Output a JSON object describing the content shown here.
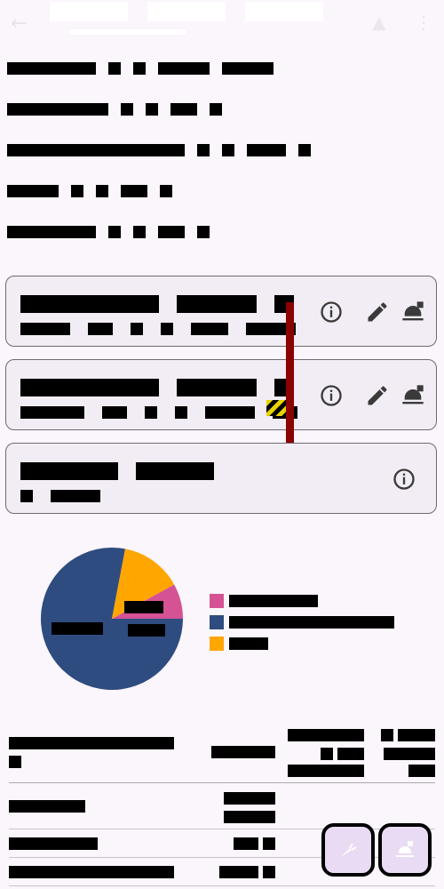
{
  "app_bar": {
    "back_icon": "arrow-back-icon",
    "tabs": [
      {
        "label": "Tab 1"
      },
      {
        "label": "Tab 2"
      },
      {
        "label": "Tab 3"
      }
    ],
    "actions": [
      "food-fire-icon",
      "more-vert-icon"
    ]
  },
  "details": [
    {
      "label": "Info line 1"
    },
    {
      "label": "Info line 2"
    },
    {
      "label": "Info line 3"
    },
    {
      "label": "Info line 4"
    },
    {
      "label": "Info line 5"
    }
  ],
  "cards": [
    {
      "title": "Card 1",
      "subtitle": "Details",
      "actions": [
        "info-icon",
        "edit-icon",
        "dish-icon"
      ]
    },
    {
      "title": "Card 2",
      "subtitle": "Details",
      "actions": [
        "info-icon",
        "edit-icon",
        "dish-icon"
      ]
    },
    {
      "title": "Card 3",
      "subtitle": "Details",
      "actions": [
        "info-icon"
      ]
    }
  ],
  "chart_data": {
    "type": "pie",
    "slices": [
      {
        "value": 8,
        "color": "#d55294"
      },
      {
        "value": 78,
        "color": "#2e4c7f"
      },
      {
        "value": 14,
        "color": "#ffa600"
      }
    ]
  },
  "table": {
    "headers": [
      "Header 1",
      "Header 2",
      "Header 3",
      "Header 4"
    ],
    "rows": [
      [
        "Row 1",
        "Value",
        "",
        ""
      ],
      [
        "Row 2",
        "Value",
        "",
        ""
      ],
      [
        "Row 3",
        "Value",
        "",
        ""
      ],
      [
        "Row 4",
        "Value",
        "",
        ""
      ]
    ]
  },
  "fabs": [
    "carrot-icon",
    "dish-icon"
  ]
}
